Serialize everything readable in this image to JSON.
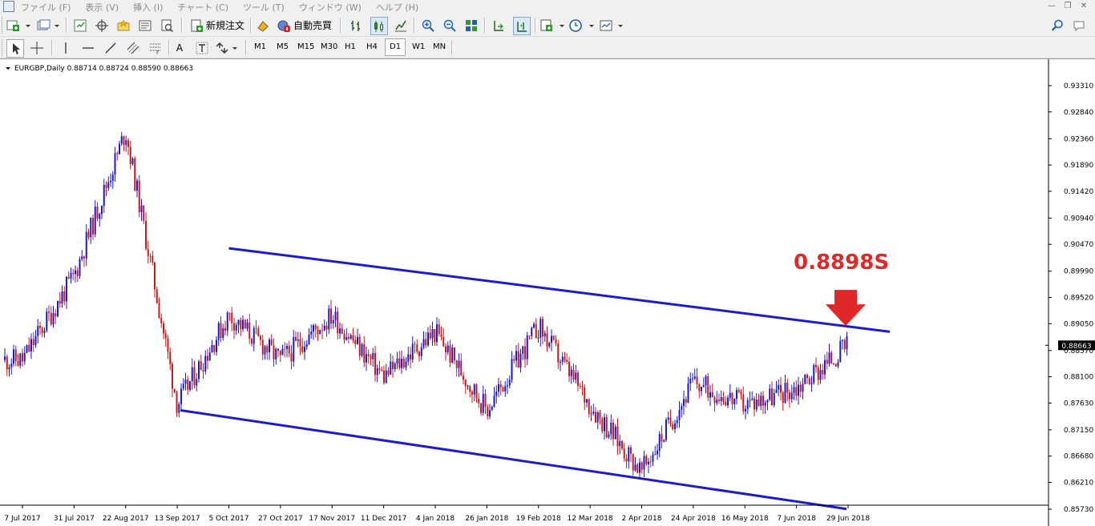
{
  "menu": [
    "ファイル (F)",
    "表示 (V)",
    "挿入 (I)",
    "チャート (C)",
    "ツール (T)",
    "ウィンドウ (W)",
    "ヘルプ (H)"
  ],
  "toolbar": {
    "new_order_label": "新規注文",
    "auto_trade_label": "自動売買"
  },
  "timeframes": [
    "M1",
    "M5",
    "M15",
    "M30",
    "H1",
    "H4",
    "D1",
    "W1",
    "MN"
  ],
  "active_timeframe": "D1",
  "chart": {
    "header": "EURGBP,Daily  0.88714 0.88724 0.88590 0.88663",
    "symbol": "EURGBP",
    "period": "Daily",
    "ohlc": [
      0.88714,
      0.88724,
      0.8859,
      0.88663
    ],
    "current_price_label": "0.88663",
    "annotation_text": "0.8898S",
    "annotation_color": "#e02828",
    "channel_color": "#1a1ad0",
    "bull_color": "#1a1ad0",
    "bear_color": "#cc1a1a"
  },
  "chart_data": {
    "type": "candlestick",
    "symbol": "EURGBP",
    "timeframe": "Daily",
    "ylim": [
      0.8573,
      0.9331
    ],
    "y_ticks": [
      "0.93310",
      "0.92840",
      "0.92360",
      "0.91890",
      "0.91420",
      "0.90940",
      "0.90470",
      "0.89990",
      "0.89520",
      "0.89050",
      "0.88570",
      "0.88100",
      "0.87630",
      "0.87150",
      "0.86680",
      "0.86210",
      "0.85730"
    ],
    "x_ticks": [
      "7 Jul 2017",
      "31 Jul 2017",
      "22 Aug 2017",
      "13 Sep 2017",
      "5 Oct 2017",
      "27 Oct 2017",
      "17 Nov 2017",
      "11 Dec 2017",
      "4 Jan 2018",
      "26 Jan 2018",
      "19 Feb 2018",
      "12 Mar 2018",
      "2 Apr 2018",
      "24 Apr 2018",
      "16 May 2018",
      "7 Jun 2018",
      "29 Jun 2018"
    ],
    "series": [
      {
        "values": [
          [
            "7 Jul 2017",
            0.884
          ],
          [
            "31 Jul 2017",
            0.899
          ],
          [
            "22 Aug 2017",
            0.925
          ],
          [
            "13 Sep 2017",
            0.876
          ],
          [
            "5 Oct 2017",
            0.892
          ],
          [
            "27 Oct 2017",
            0.884
          ],
          [
            "17 Nov 2017",
            0.892
          ],
          [
            "11 Dec 2017",
            0.881
          ],
          [
            "4 Jan 2018",
            0.889
          ],
          [
            "26 Jan 2018",
            0.875
          ],
          [
            "19 Feb 2018",
            0.89
          ],
          [
            "12 Mar 2018",
            0.876
          ],
          [
            "2 Apr 2018",
            0.864
          ],
          [
            "24 Apr 2018",
            0.88
          ],
          [
            "16 May 2018",
            0.876
          ],
          [
            "7 Jun 2018",
            0.879
          ],
          [
            "29 Jun 2018",
            0.8866
          ]
        ]
      }
    ],
    "trendlines": [
      {
        "from": [
          "5 Oct 2017",
          0.904
        ],
        "to": [
          "29 Jun 2018",
          0.89
        ]
      },
      {
        "from": [
          "13 Sep 2017",
          0.875
        ],
        "to": [
          "29 Jun 2018",
          0.8573
        ]
      }
    ],
    "last_price": 0.88663,
    "annotation": {
      "text": "0.8898S",
      "price": 0.8898
    }
  }
}
